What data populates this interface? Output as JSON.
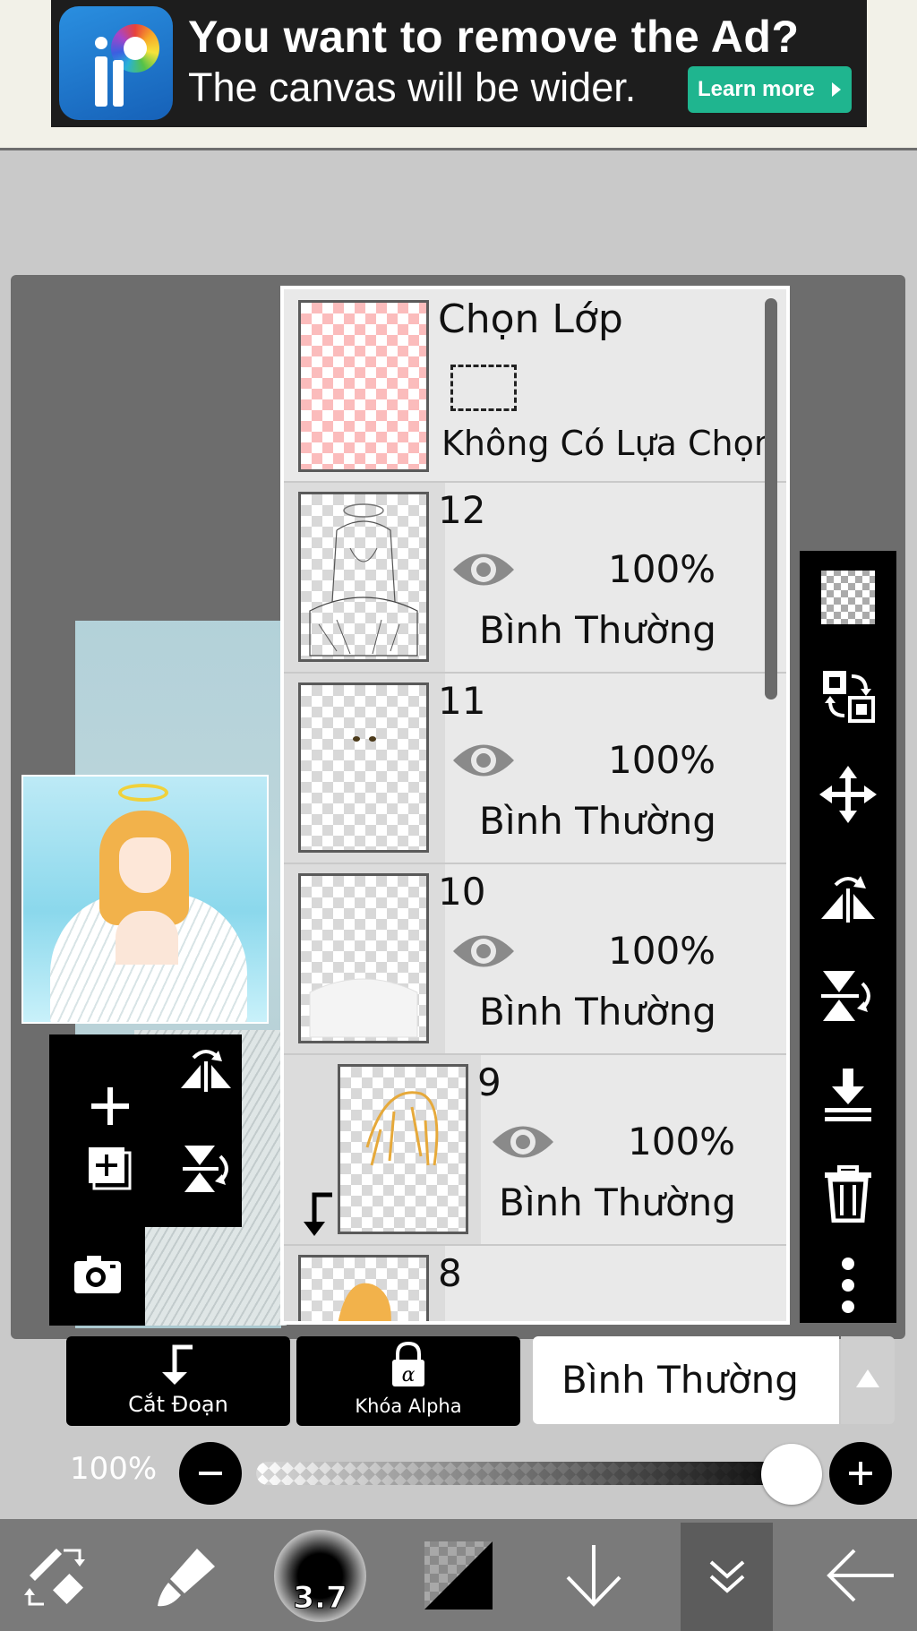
{
  "ad": {
    "title": "You want to remove the Ad?",
    "subtitle": "The canvas will be wider.",
    "button": "Learn more"
  },
  "selection_layer": {
    "title": "Chọn Lớp",
    "status": "Không Có Lựa Chọn"
  },
  "layers": [
    {
      "number": "12",
      "opacity": "100%",
      "blend": "Bình Thường",
      "visible": true
    },
    {
      "number": "11",
      "opacity": "100%",
      "blend": "Bình Thường",
      "visible": true
    },
    {
      "number": "10",
      "opacity": "100%",
      "blend": "Bình Thường",
      "visible": true
    },
    {
      "number": "9",
      "opacity": "100%",
      "blend": "Bình Thường",
      "visible": true,
      "clipped": true
    },
    {
      "number": "8"
    }
  ],
  "bottom_controls": {
    "clip_label": "Cắt Đoạn",
    "alpha_lock_label": "Khóa Alpha",
    "blend_mode": "Bình Thường",
    "opacity_label": "100%",
    "opacity_fraction": 1.0
  },
  "toolbar": {
    "brush_size": "3.7"
  },
  "colors": {
    "ad_button": "#1fb58f",
    "panel_bg": "#e9e9e9",
    "selection_thumb": "#fbbcbc"
  },
  "icons": {
    "left_tools": [
      "add-layer-icon",
      "flip-horizontal-icon",
      "duplicate-layer-icon",
      "flip-vertical-icon",
      "camera-icon"
    ],
    "right_tools": [
      "transparent-bg-icon",
      "swap-layer-icon",
      "move-icon",
      "flip-horizontal-icon",
      "flip-vertical-icon",
      "merge-down-icon",
      "trash-icon",
      "more-icon"
    ],
    "bottom_bar": [
      "swap-tools-icon",
      "brush-icon",
      "brush-size-icon",
      "color-icon",
      "arrow-down-icon",
      "layers-icon",
      "back-arrow-icon"
    ]
  }
}
